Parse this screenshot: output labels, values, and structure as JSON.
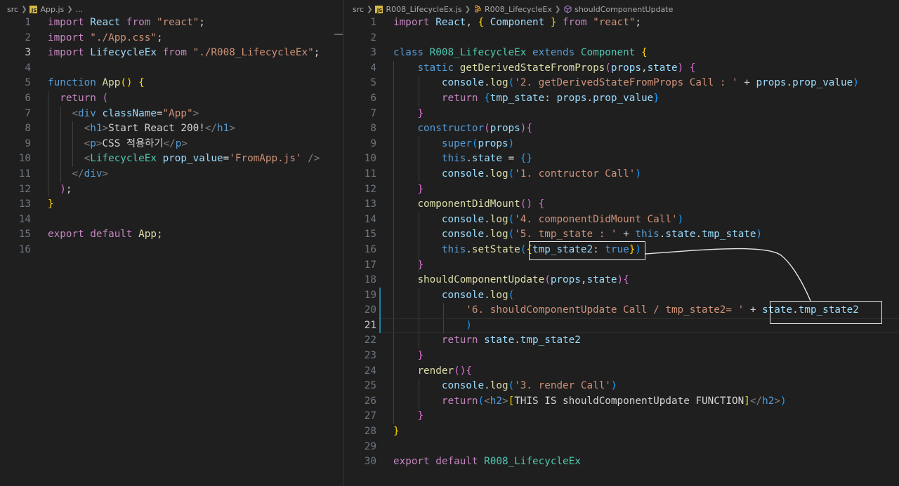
{
  "left_editor": {
    "breadcrumb": [
      "src",
      "App.js",
      "..."
    ],
    "active_line": 3,
    "lines": [
      [
        [
          "kw",
          "import"
        ],
        [
          "pl",
          " "
        ],
        [
          "var",
          "React"
        ],
        [
          "pl",
          " "
        ],
        [
          "kw",
          "from"
        ],
        [
          "pl",
          " "
        ],
        [
          "str",
          "\"react\""
        ],
        [
          "pl",
          ";"
        ]
      ],
      [
        [
          "kw",
          "import"
        ],
        [
          "pl",
          " "
        ],
        [
          "str",
          "\"./App.css\""
        ],
        [
          "pl",
          ";"
        ]
      ],
      [
        [
          "kw",
          "import"
        ],
        [
          "pl",
          " "
        ],
        [
          "var",
          "LifecycleEx"
        ],
        [
          "pl",
          " "
        ],
        [
          "kw",
          "from"
        ],
        [
          "pl",
          " "
        ],
        [
          "str",
          "\"./R008_LifecycleEx\""
        ],
        [
          "pl",
          ";"
        ]
      ],
      [],
      [
        [
          "kb",
          "function"
        ],
        [
          "pl",
          " "
        ],
        [
          "fn",
          "App"
        ],
        [
          "b1",
          "()"
        ],
        [
          "pl",
          " "
        ],
        [
          "b1",
          "{"
        ]
      ],
      [
        [
          "pl",
          "  "
        ],
        [
          "kw",
          "return"
        ],
        [
          "pl",
          " "
        ],
        [
          "b2",
          "("
        ]
      ],
      [
        [
          "pl",
          "    "
        ],
        [
          "ang",
          "<"
        ],
        [
          "tag",
          "div"
        ],
        [
          "pl",
          " "
        ],
        [
          "var",
          "className"
        ],
        [
          "pl",
          "="
        ],
        [
          "str",
          "\"App\""
        ],
        [
          "ang",
          ">"
        ]
      ],
      [
        [
          "pl",
          "      "
        ],
        [
          "ang",
          "<"
        ],
        [
          "tag",
          "h1"
        ],
        [
          "ang",
          ">"
        ],
        [
          "pl",
          "Start React 200!"
        ],
        [
          "ang",
          "</"
        ],
        [
          "tag",
          "h1"
        ],
        [
          "ang",
          ">"
        ]
      ],
      [
        [
          "pl",
          "      "
        ],
        [
          "ang",
          "<"
        ],
        [
          "tag",
          "p"
        ],
        [
          "ang",
          ">"
        ],
        [
          "pl",
          "CSS 적용하기"
        ],
        [
          "ang",
          "</"
        ],
        [
          "tag",
          "p"
        ],
        [
          "ang",
          ">"
        ]
      ],
      [
        [
          "pl",
          "      "
        ],
        [
          "ang",
          "<"
        ],
        [
          "cls",
          "LifecycleEx"
        ],
        [
          "pl",
          " "
        ],
        [
          "var",
          "prop_value"
        ],
        [
          "pl",
          "="
        ],
        [
          "str",
          "'FromApp.js'"
        ],
        [
          "pl",
          " "
        ],
        [
          "ang",
          "/>"
        ]
      ],
      [
        [
          "pl",
          "    "
        ],
        [
          "ang",
          "</"
        ],
        [
          "tag",
          "div"
        ],
        [
          "ang",
          ">"
        ]
      ],
      [
        [
          "pl",
          "  "
        ],
        [
          "b2",
          ")"
        ],
        [
          "pl",
          ";"
        ]
      ],
      [
        [
          "b1",
          "}"
        ]
      ],
      [],
      [
        [
          "kw",
          "export"
        ],
        [
          "pl",
          " "
        ],
        [
          "kw",
          "default"
        ],
        [
          "pl",
          " "
        ],
        [
          "fn",
          "App"
        ],
        [
          "pl",
          ";"
        ]
      ],
      []
    ]
  },
  "right_editor": {
    "breadcrumb": [
      "src",
      "R008_LifecycleEx.js",
      "R008_LifecycleEx",
      "shouldComponentUpdate"
    ],
    "active_line": 21,
    "lines": [
      [
        [
          "kw",
          "import"
        ],
        [
          "pl",
          " "
        ],
        [
          "var",
          "React"
        ],
        [
          "pl",
          ", "
        ],
        [
          "b1",
          "{"
        ],
        [
          "pl",
          " "
        ],
        [
          "var",
          "Component"
        ],
        [
          "pl",
          " "
        ],
        [
          "b1",
          "}"
        ],
        [
          "pl",
          " "
        ],
        [
          "kw",
          "from"
        ],
        [
          "pl",
          " "
        ],
        [
          "str",
          "\"react\""
        ],
        [
          "pl",
          ";"
        ]
      ],
      [],
      [
        [
          "kb",
          "class"
        ],
        [
          "pl",
          " "
        ],
        [
          "cls",
          "R008_LifecycleEx"
        ],
        [
          "pl",
          " "
        ],
        [
          "kb",
          "extends"
        ],
        [
          "pl",
          " "
        ],
        [
          "cls",
          "Component"
        ],
        [
          "pl",
          " "
        ],
        [
          "b1",
          "{"
        ]
      ],
      [
        [
          "pl",
          "    "
        ],
        [
          "kb",
          "static"
        ],
        [
          "pl",
          " "
        ],
        [
          "fn",
          "getDerivedStateFromProps"
        ],
        [
          "b2",
          "("
        ],
        [
          "var",
          "props"
        ],
        [
          "pl",
          ","
        ],
        [
          "var",
          "state"
        ],
        [
          "b2",
          ")"
        ],
        [
          "pl",
          " "
        ],
        [
          "b2",
          "{"
        ]
      ],
      [
        [
          "pl",
          "        "
        ],
        [
          "var",
          "console"
        ],
        [
          "pl",
          "."
        ],
        [
          "fn",
          "log"
        ],
        [
          "b3",
          "("
        ],
        [
          "str",
          "'2. getDerivedStateFromProps Call : '"
        ],
        [
          "pl",
          " + "
        ],
        [
          "var",
          "props"
        ],
        [
          "pl",
          "."
        ],
        [
          "var",
          "prop_value"
        ],
        [
          "b3",
          ")"
        ]
      ],
      [
        [
          "pl",
          "        "
        ],
        [
          "kw",
          "return"
        ],
        [
          "pl",
          " "
        ],
        [
          "b3",
          "{"
        ],
        [
          "var",
          "tmp_state"
        ],
        [
          "pl",
          ": "
        ],
        [
          "var",
          "props"
        ],
        [
          "pl",
          "."
        ],
        [
          "var",
          "prop_value"
        ],
        [
          "b3",
          "}"
        ]
      ],
      [
        [
          "pl",
          "    "
        ],
        [
          "b2",
          "}"
        ]
      ],
      [
        [
          "pl",
          "    "
        ],
        [
          "kb",
          "constructor"
        ],
        [
          "b2",
          "("
        ],
        [
          "var",
          "props"
        ],
        [
          "b2",
          ")"
        ],
        [
          "b2",
          "{"
        ]
      ],
      [
        [
          "pl",
          "        "
        ],
        [
          "kb",
          "super"
        ],
        [
          "b3",
          "("
        ],
        [
          "var",
          "props"
        ],
        [
          "b3",
          ")"
        ]
      ],
      [
        [
          "pl",
          "        "
        ],
        [
          "kb",
          "this"
        ],
        [
          "pl",
          "."
        ],
        [
          "var",
          "state"
        ],
        [
          "pl",
          " = "
        ],
        [
          "b3",
          "{}"
        ]
      ],
      [
        [
          "pl",
          "        "
        ],
        [
          "var",
          "console"
        ],
        [
          "pl",
          "."
        ],
        [
          "fn",
          "log"
        ],
        [
          "b3",
          "("
        ],
        [
          "str",
          "'1. contructor Call'"
        ],
        [
          "b3",
          ")"
        ]
      ],
      [
        [
          "pl",
          "    "
        ],
        [
          "b2",
          "}"
        ]
      ],
      [
        [
          "pl",
          "    "
        ],
        [
          "fn",
          "componentDidMount"
        ],
        [
          "b2",
          "()"
        ],
        [
          "pl",
          " "
        ],
        [
          "b2",
          "{"
        ]
      ],
      [
        [
          "pl",
          "        "
        ],
        [
          "var",
          "console"
        ],
        [
          "pl",
          "."
        ],
        [
          "fn",
          "log"
        ],
        [
          "b3",
          "("
        ],
        [
          "str",
          "'4. componentDidMount Call'"
        ],
        [
          "b3",
          ")"
        ]
      ],
      [
        [
          "pl",
          "        "
        ],
        [
          "var",
          "console"
        ],
        [
          "pl",
          "."
        ],
        [
          "fn",
          "log"
        ],
        [
          "b3",
          "("
        ],
        [
          "str",
          "'5. tmp_state : '"
        ],
        [
          "pl",
          " + "
        ],
        [
          "kb",
          "this"
        ],
        [
          "pl",
          "."
        ],
        [
          "var",
          "state"
        ],
        [
          "pl",
          "."
        ],
        [
          "var",
          "tmp_state"
        ],
        [
          "b3",
          ")"
        ]
      ],
      [
        [
          "pl",
          "        "
        ],
        [
          "kb",
          "this"
        ],
        [
          "pl",
          "."
        ],
        [
          "fn",
          "setState"
        ],
        [
          "b3",
          "("
        ],
        [
          "b1",
          "{"
        ],
        [
          "var",
          "tmp_state2"
        ],
        [
          "pl",
          ": "
        ],
        [
          "kb",
          "true"
        ],
        [
          "b1",
          "}"
        ],
        [
          "b3",
          ")"
        ]
      ],
      [
        [
          "pl",
          "    "
        ],
        [
          "b2",
          "}"
        ]
      ],
      [
        [
          "pl",
          "    "
        ],
        [
          "fn",
          "shouldComponentUpdate"
        ],
        [
          "b2",
          "("
        ],
        [
          "var",
          "props"
        ],
        [
          "pl",
          ","
        ],
        [
          "var",
          "state"
        ],
        [
          "b2",
          ")"
        ],
        [
          "b2",
          "{"
        ]
      ],
      [
        [
          "pl",
          "        "
        ],
        [
          "var",
          "console"
        ],
        [
          "pl",
          "."
        ],
        [
          "fn",
          "log"
        ],
        [
          "b3",
          "("
        ]
      ],
      [
        [
          "pl",
          "            "
        ],
        [
          "str",
          "'6. shouldComponentUpdate Call / tmp_state2= '"
        ],
        [
          "pl",
          " + "
        ],
        [
          "var",
          "state"
        ],
        [
          "pl",
          "."
        ],
        [
          "var",
          "tmp_state2"
        ]
      ],
      [
        [
          "pl",
          "            "
        ],
        [
          "b3",
          ")"
        ]
      ],
      [
        [
          "pl",
          "        "
        ],
        [
          "kw",
          "return"
        ],
        [
          "pl",
          " "
        ],
        [
          "var",
          "state"
        ],
        [
          "pl",
          "."
        ],
        [
          "var",
          "tmp_state2"
        ]
      ],
      [
        [
          "pl",
          "    "
        ],
        [
          "b2",
          "}"
        ]
      ],
      [
        [
          "pl",
          "    "
        ],
        [
          "fn",
          "render"
        ],
        [
          "b2",
          "()"
        ],
        [
          "b2",
          "{"
        ]
      ],
      [
        [
          "pl",
          "        "
        ],
        [
          "var",
          "console"
        ],
        [
          "pl",
          "."
        ],
        [
          "fn",
          "log"
        ],
        [
          "b3",
          "("
        ],
        [
          "str",
          "'3. render Call'"
        ],
        [
          "b3",
          ")"
        ]
      ],
      [
        [
          "pl",
          "        "
        ],
        [
          "kw",
          "return"
        ],
        [
          "b3",
          "("
        ],
        [
          "ang",
          "<"
        ],
        [
          "tag",
          "h2"
        ],
        [
          "ang",
          ">"
        ],
        [
          "b1",
          "["
        ],
        [
          "pl",
          "THIS IS shouldComponentUpdate FUNCTION"
        ],
        [
          "b1",
          "]"
        ],
        [
          "ang",
          "</"
        ],
        [
          "tag",
          "h2"
        ],
        [
          "ang",
          ">"
        ],
        [
          "b3",
          ")"
        ]
      ],
      [
        [
          "pl",
          "    "
        ],
        [
          "b2",
          "}"
        ]
      ],
      [
        [
          "b1",
          "}"
        ]
      ],
      [],
      [
        [
          "kw",
          "export"
        ],
        [
          "pl",
          " "
        ],
        [
          "kw",
          "default"
        ],
        [
          "pl",
          " "
        ],
        [
          "cls",
          "R008_LifecycleEx"
        ]
      ]
    ]
  },
  "colors": {
    "background": "#1f1f1f",
    "annotation": "#e8e8e8",
    "modified_gutter": "#1b81a8"
  }
}
